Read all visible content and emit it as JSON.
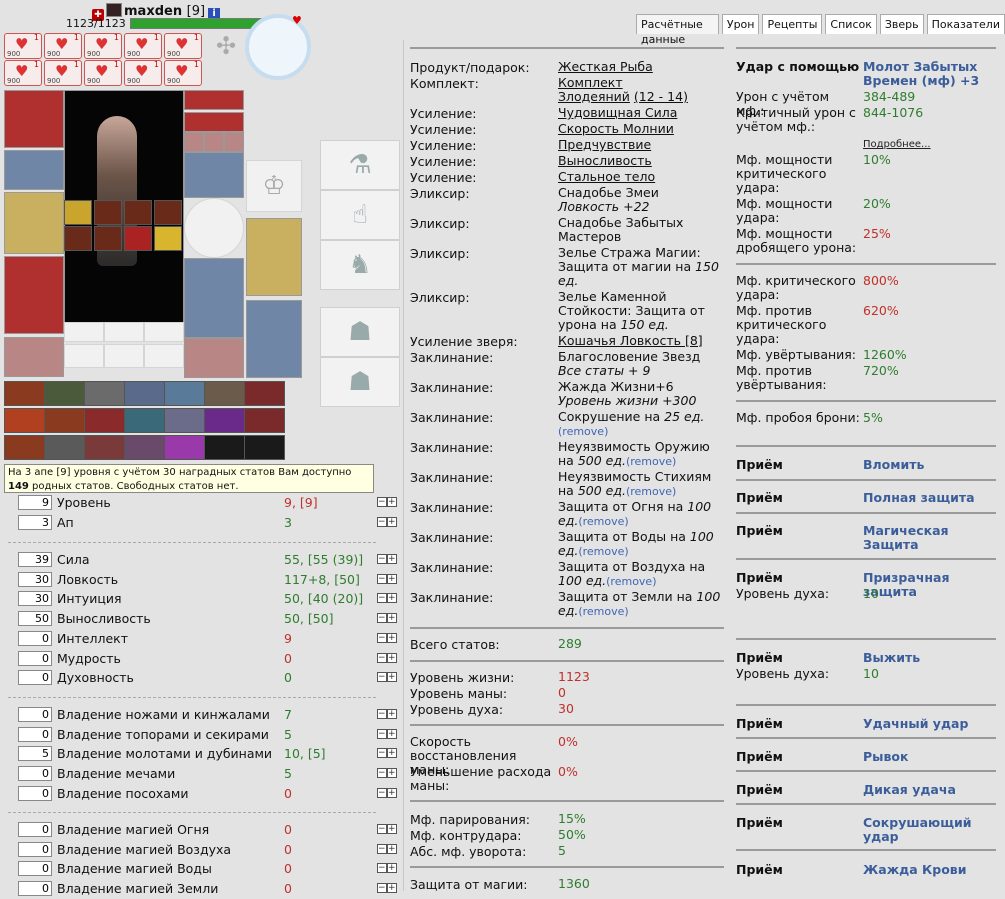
{
  "header": {
    "name": "maxden",
    "level": "[9]",
    "info": "i",
    "hp": "1123/1123"
  },
  "tabs": [
    "Расчётные данные",
    "Урон",
    "Рецепты",
    "Список",
    "Зверь",
    "Показатели"
  ],
  "scroll_label": "900",
  "scroll_count": "1",
  "hint": {
    "text_before": "На 3 апе [9] уровня с учётом 30 наградных статов Вам доступно ",
    "free": "149",
    "text_after": " родных статов. Свободных статов нет."
  },
  "stats_basic": [
    {
      "input": "9",
      "label": "Уровень",
      "value": "9, [9]",
      "color": "red"
    },
    {
      "input": "3",
      "label": "Ап",
      "value": "3",
      "color": "green"
    }
  ],
  "stats_main": [
    {
      "input": "39",
      "label": "Сила",
      "value": "55, [55 (39)]",
      "color": "green"
    },
    {
      "input": "30",
      "label": "Ловкость",
      "value": "117+8, [50]",
      "color": "green"
    },
    {
      "input": "30",
      "label": "Интуиция",
      "value": "50, [40 (20)]",
      "color": "green"
    },
    {
      "input": "50",
      "label": "Выносливость",
      "value": "50, [50]",
      "color": "green"
    },
    {
      "input": "0",
      "label": "Интеллект",
      "value": "9",
      "color": "red"
    },
    {
      "input": "0",
      "label": "Мудрость",
      "value": "0",
      "color": "red"
    },
    {
      "input": "0",
      "label": "Духовность",
      "value": "0",
      "color": "green"
    }
  ],
  "stats_weapon": [
    {
      "input": "0",
      "label": "Владение ножами и кинжалами",
      "value": "7",
      "color": "green"
    },
    {
      "input": "0",
      "label": "Владение топорами и секирами",
      "value": "5",
      "color": "green"
    },
    {
      "input": "5",
      "label": "Владение молотами и дубинами",
      "value": "10, [5]",
      "color": "green"
    },
    {
      "input": "0",
      "label": "Владение мечами",
      "value": "5",
      "color": "green"
    },
    {
      "input": "0",
      "label": "Владение посохами",
      "value": "0",
      "color": "red"
    }
  ],
  "stats_magic": [
    {
      "input": "0",
      "label": "Владение магией Огня",
      "value": "0",
      "color": "red"
    },
    {
      "input": "0",
      "label": "Владение магией Воздуха",
      "value": "0",
      "color": "red"
    },
    {
      "input": "0",
      "label": "Владение магией Воды",
      "value": "0",
      "color": "red"
    },
    {
      "input": "0",
      "label": "Владение магией Земли",
      "value": "0",
      "color": "red"
    }
  ],
  "middle": {
    "product_label": "Продукт/подарок:",
    "product_value": "Жесткая Рыба",
    "set_label": "Комплект:",
    "set_value_1": "Комплект",
    "set_value_2": "Злодеяний",
    "set_range": "(12 - 14)",
    "boost_label": "Усиление:",
    "boosts": [
      "Чудовищная Сила",
      "Скорость Молнии",
      "Предчувствие",
      "Выносливость",
      "Стальное тело"
    ],
    "elixir_label": "Эликсир:",
    "elixirs": [
      {
        "name": "Снадобье Змеи ",
        "italic": "Ловкость +22"
      },
      {
        "name": "Снадобье Забытых Мастеров",
        "italic": ""
      },
      {
        "name": "Зелье Стража Магии: Защита от магии на ",
        "italic": "150 ед."
      },
      {
        "name": "Зелье Каменной Стойкости: Защита от урона на ",
        "italic": "150 ед."
      }
    ],
    "pet_label": "Усиление зверя:",
    "pet_value": "Кошачья Ловкость [8]",
    "spell_label": "Заклинание:",
    "spells": [
      {
        "name": "Благословение Звезд ",
        "italic": "Все статы + 9",
        "remove": ""
      },
      {
        "name": "Жажда Жизни+6 ",
        "italic": "Уровень жизни +300",
        "remove": ""
      },
      {
        "name": "Сокрушение на ",
        "italic": "25 ед.",
        "remove": "(remove)"
      },
      {
        "name": "Неуязвимость Оружию на ",
        "italic": "500 ед.",
        "remove": "(remove)"
      },
      {
        "name": "Неуязвимость Стихиям на ",
        "italic": "500 ед.",
        "remove": "(remove)"
      },
      {
        "name": "Защита от Огня на ",
        "italic": "100 ед.",
        "remove": "(remove)"
      },
      {
        "name": "Защита от Воды на ",
        "italic": "100 ед.",
        "remove": "(remove)"
      },
      {
        "name": "Защита от Воздуха на ",
        "italic": "100 ед.",
        "remove": "(remove)"
      },
      {
        "name": "Защита от Земли на ",
        "italic": "100 ед.",
        "remove": "(remove)"
      }
    ],
    "total_label": "Всего статов:",
    "total_value": "289",
    "life_label": "Уровень жизни:",
    "life_value": "1123",
    "mana_label": "Уровень маны:",
    "mana_value": "0",
    "spirit_label": "Уровень духа:",
    "spirit_value": "30",
    "mana_regen_label": "Скорость восстановления маны:",
    "mana_regen_value": "0%",
    "mana_cost_label": "Уменьшение расхода маны:",
    "mana_cost_value": "0%",
    "parry_label": "Мф. парирования:",
    "parry_value": "15%",
    "counter_label": "Мф. контрудара:",
    "counter_value": "50%",
    "abs_dodge_label": "Абс. мф. уворота:",
    "abs_dodge_value": "5",
    "magic_def_label": "Защита от магии:",
    "magic_def_value": "1360"
  },
  "right": {
    "weapon_label": "Удар с помощью",
    "weapon_value": "Молот Забытых Времен (мф) +3",
    "damage_label": "Урон с учётом мф.:",
    "damage_value": "384-489",
    "crit_damage_label": "Критичный урон с учётом мф.:",
    "crit_damage_value": "844-1076",
    "more": "Подробнее...",
    "power_crit_label": "Мф. мощности критического удара:",
    "power_crit_value": "10%",
    "power_hit_label": "Мф. мощности удара:",
    "power_hit_value": "20%",
    "power_crush_label": "Мф. мощности дробящего урона:",
    "power_crush_value": "25%",
    "crit_label": "Мф. критического удара:",
    "crit_value": "800%",
    "anticrit_label": "Мф. против критического удара:",
    "anticrit_value": "620%",
    "dodge_label": "Мф. увёртывания:",
    "dodge_value": "1260%",
    "antidodge_label": "Мф. против увёртывания:",
    "antidodge_value": "720%",
    "armor_pierce_label": "Мф. пробоя брони:",
    "armor_pierce_value": "5%",
    "priem_label": "Приём",
    "spirit_level_label": "Уровень духа:",
    "priems": [
      {
        "name": "Вломить",
        "spirit": ""
      },
      {
        "name": "Полная защита",
        "spirit": ""
      },
      {
        "name": "Магическая Защита",
        "spirit": ""
      },
      {
        "name": "Призрачная защита",
        "spirit": "10"
      },
      {
        "name": "Выжить",
        "spirit": "10"
      },
      {
        "name": "Удачный удар",
        "spirit": ""
      },
      {
        "name": "Рывок",
        "spirit": ""
      },
      {
        "name": "Дикая удача",
        "spirit": ""
      },
      {
        "name": "Сокрушающий удар",
        "spirit": ""
      },
      {
        "name": "Жажда Крови",
        "spirit": ""
      }
    ]
  }
}
